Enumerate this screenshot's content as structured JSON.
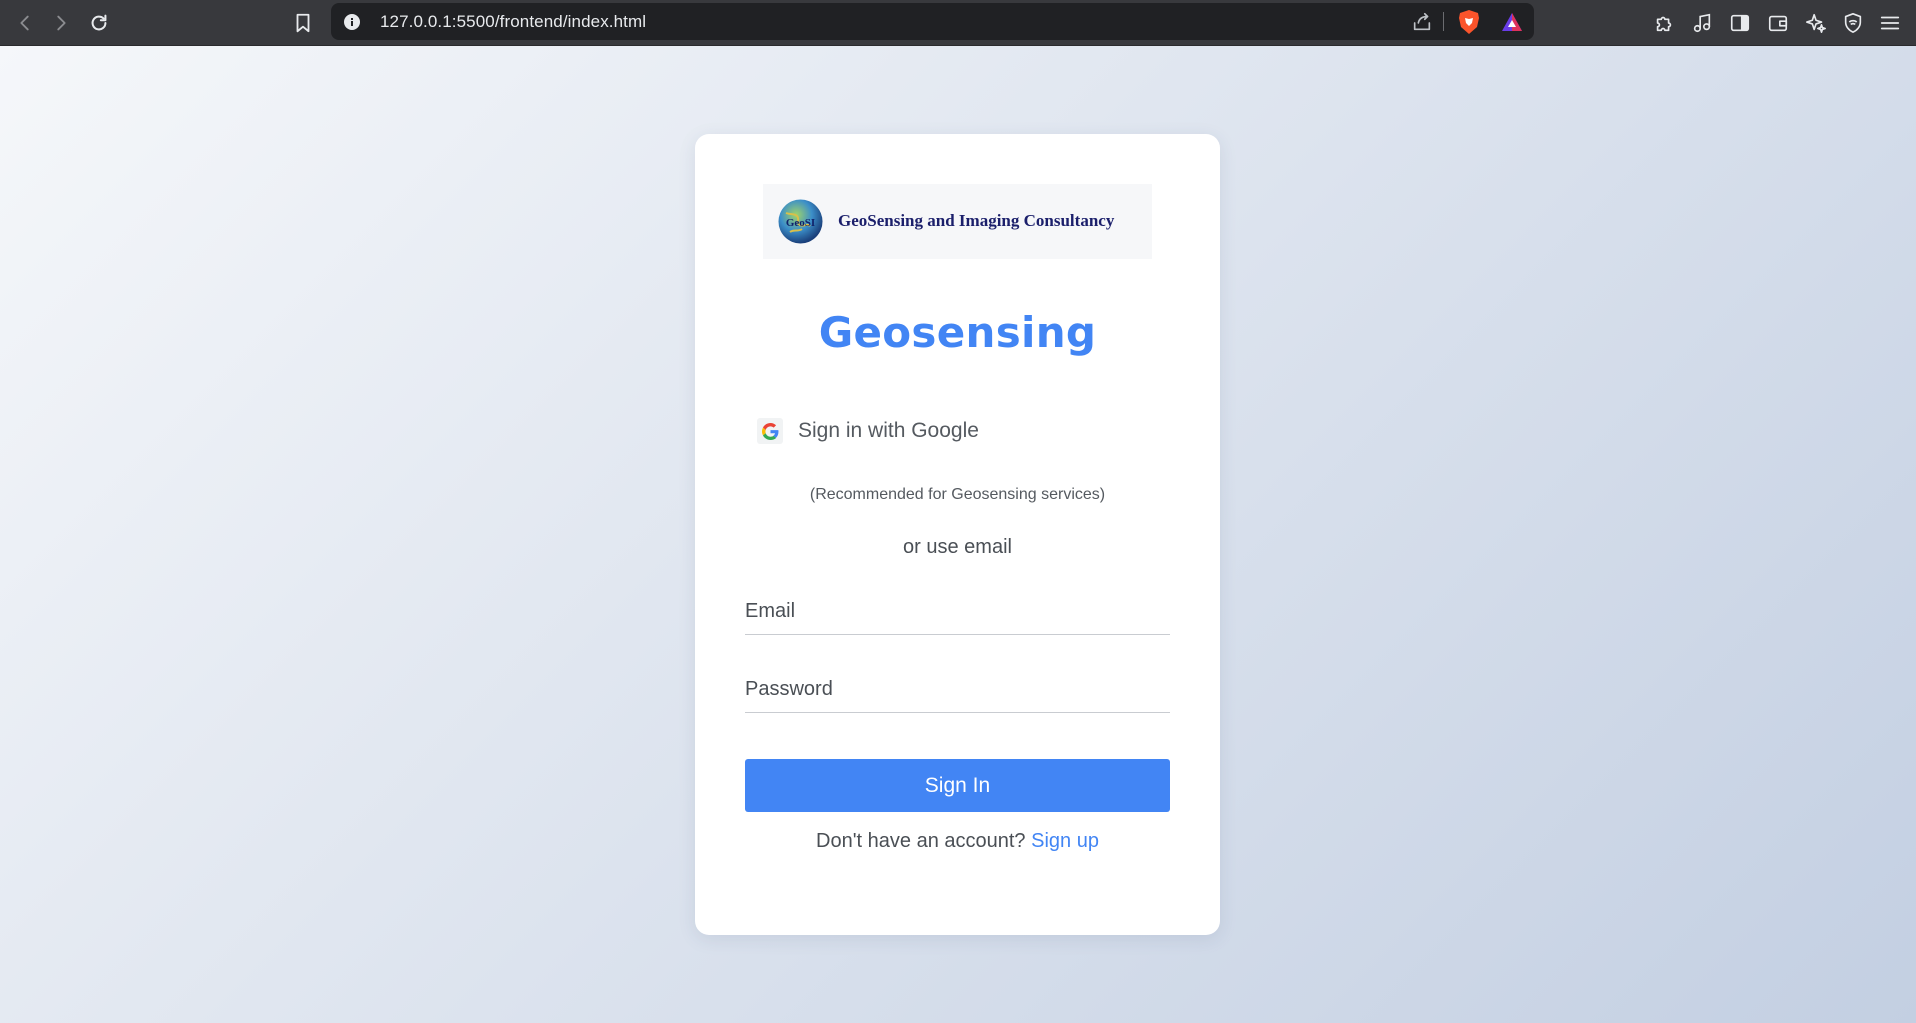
{
  "browser": {
    "url": "127.0.0.1:5500/frontend/index.html",
    "icons": {
      "back": "back-arrow-icon",
      "forward": "forward-arrow-icon",
      "reload": "reload-icon",
      "bookmark": "bookmark-icon",
      "site_info": "info-icon",
      "share": "share-icon",
      "shields": "brave-shields-icon",
      "rewards": "brave-rewards-icon",
      "extensions": "puzzle-icon",
      "media": "music-note-icon",
      "sidebar": "sidebar-icon",
      "wallet": "wallet-icon",
      "leo": "sparkle-icon",
      "vpn": "shield-icon",
      "menu": "hamburger-menu-icon"
    }
  },
  "login": {
    "logo_text": "GeoSensing and Imaging Consultancy",
    "logo_badge": "GeoSI",
    "title": "Geosensing",
    "google_button_label": "Sign in with Google",
    "recommendation": "(Recommended for Geosensing services)",
    "divider_text": "or use email",
    "email_placeholder": "Email",
    "password_placeholder": "Password",
    "submit_label": "Sign In",
    "signup_prompt": "Don't have an account?",
    "signup_link": "Sign up"
  },
  "colors": {
    "accent": "#4285f4",
    "logo_text": "#1b1f6b",
    "chrome_bg": "#38393d",
    "urlbar_bg": "#202124"
  }
}
